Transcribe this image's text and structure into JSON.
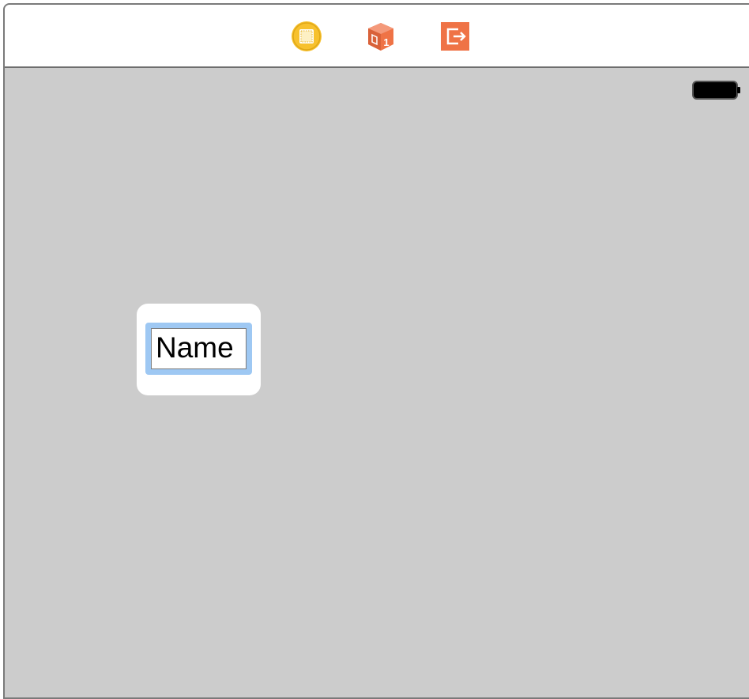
{
  "scene_dock": {
    "icons": [
      {
        "name": "view-controller-icon",
        "color": "#f7c12e"
      },
      {
        "name": "first-responder-icon",
        "color": "#ef7346",
        "badge": "1"
      },
      {
        "name": "exit-icon",
        "color": "#ef7346"
      }
    ]
  },
  "status_bar": {
    "battery": "battery-icon"
  },
  "popup": {
    "text_field_value": "Name",
    "focus_ring_color": "#9ec8f3"
  },
  "colors": {
    "canvas": "#cccccc",
    "dock": "#ffffff"
  }
}
